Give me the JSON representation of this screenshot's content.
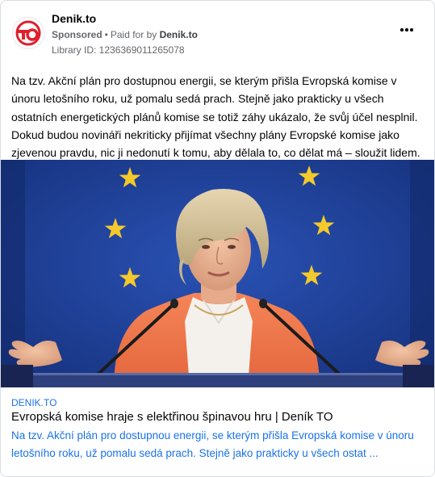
{
  "post": {
    "page_name": "Denik.to",
    "sponsored_label": "Sponsored",
    "paid_for_by_label": "Paid for by",
    "paid_for_by_name": "Denik.to",
    "library_id": "Library ID: 1236369011265078",
    "body_text": "Na tzv. Akční plán pro dostupnou energii, se kterým přišla Evropská komise v únoru letošního roku, už pomalu sedá prach. Stejně jako prakticky u všech ostatních energetických plánů komise se totiž záhy ukázalo, že svůj účel nesplnil. Dokud budou novináři nekriticky přijímat všechny plány Evropské komise jako zjevenou pravdu, nic ji nedonutí k tomu, aby dělala to, co dělat má – sloužit lidem."
  },
  "logo": {
    "text": "TO",
    "color": "#e0202c"
  },
  "link": {
    "domain": "DENIK.TO",
    "title": "Evropská komise hraje s elektřinou špinavou hru | Deník TO",
    "description": "Na tzv. Akční plán pro dostupnou energii, se kterým přišla Evropská komise v únoru letošního roku, už pomalu sedá prach. Stejně jako prakticky u všech ostat ..."
  },
  "image": {
    "subject": "speaker-at-podium-eu-flag",
    "bg_color": "#1e3f99",
    "star_color": "#f4c92b",
    "jacket_color": "#f0764b"
  }
}
